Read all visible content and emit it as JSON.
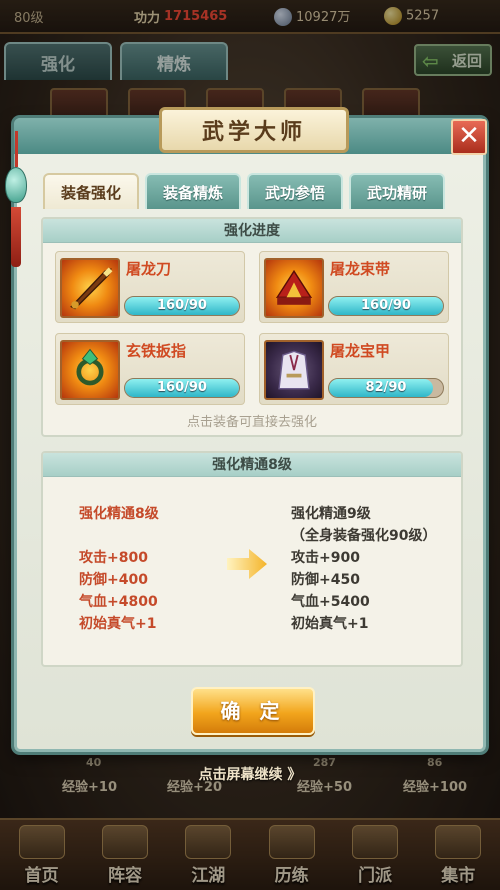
{
  "top_bar": {
    "level": "80级",
    "power_label": "功力",
    "power_value": "1715465",
    "silver": "10927万",
    "gold": "5257"
  },
  "background_tabs": [
    "强化",
    "精炼"
  ],
  "back_button": "返回",
  "dialog": {
    "title": "武学大师",
    "close": "✕",
    "tabs": [
      {
        "label": "装备强化",
        "active": true
      },
      {
        "label": "装备精炼",
        "active": false
      },
      {
        "label": "武功参悟",
        "active": false
      },
      {
        "label": "武功精研",
        "active": false
      }
    ],
    "progress_panel": {
      "header": "强化进度",
      "items": [
        {
          "name": "屠龙刀",
          "progress": "160/90",
          "fill": 1.0
        },
        {
          "name": "屠龙束带",
          "progress": "160/90",
          "fill": 1.0
        },
        {
          "name": "玄铁扳指",
          "progress": "160/90",
          "fill": 1.0
        },
        {
          "name": "屠龙宝甲",
          "progress": "82/90",
          "fill": 0.911
        }
      ],
      "hint": "点击装备可直接去强化"
    },
    "mastery_panel": {
      "header": "强化精通8级",
      "current": {
        "title": "强化精通8级",
        "stats": [
          "攻击+800",
          "防御+400",
          "气血+4800",
          "初始真气+1"
        ]
      },
      "next": {
        "title": "强化精通9级",
        "condition": "（全身装备强化90级）",
        "stats": [
          "攻击+900",
          "防御+450",
          "气血+5400",
          "初始真气+1"
        ]
      }
    },
    "confirm": "确 定"
  },
  "bottom": {
    "levels": [
      "40",
      "287",
      "86"
    ],
    "exp": [
      "经验+10",
      "经验+20",
      "经验+50",
      "经验+100"
    ],
    "tap_continue": "点击屏幕继续 》"
  },
  "nav": [
    "首页",
    "阵容",
    "江湖",
    "历练",
    "门派",
    "集市"
  ],
  "colors": {
    "accent_teal": "#5a958c",
    "stat_red": "#c54a2a",
    "equip_name": "#d04a22",
    "power_red": "#ff4e3a",
    "confirm_gold": "#f2a51c"
  }
}
